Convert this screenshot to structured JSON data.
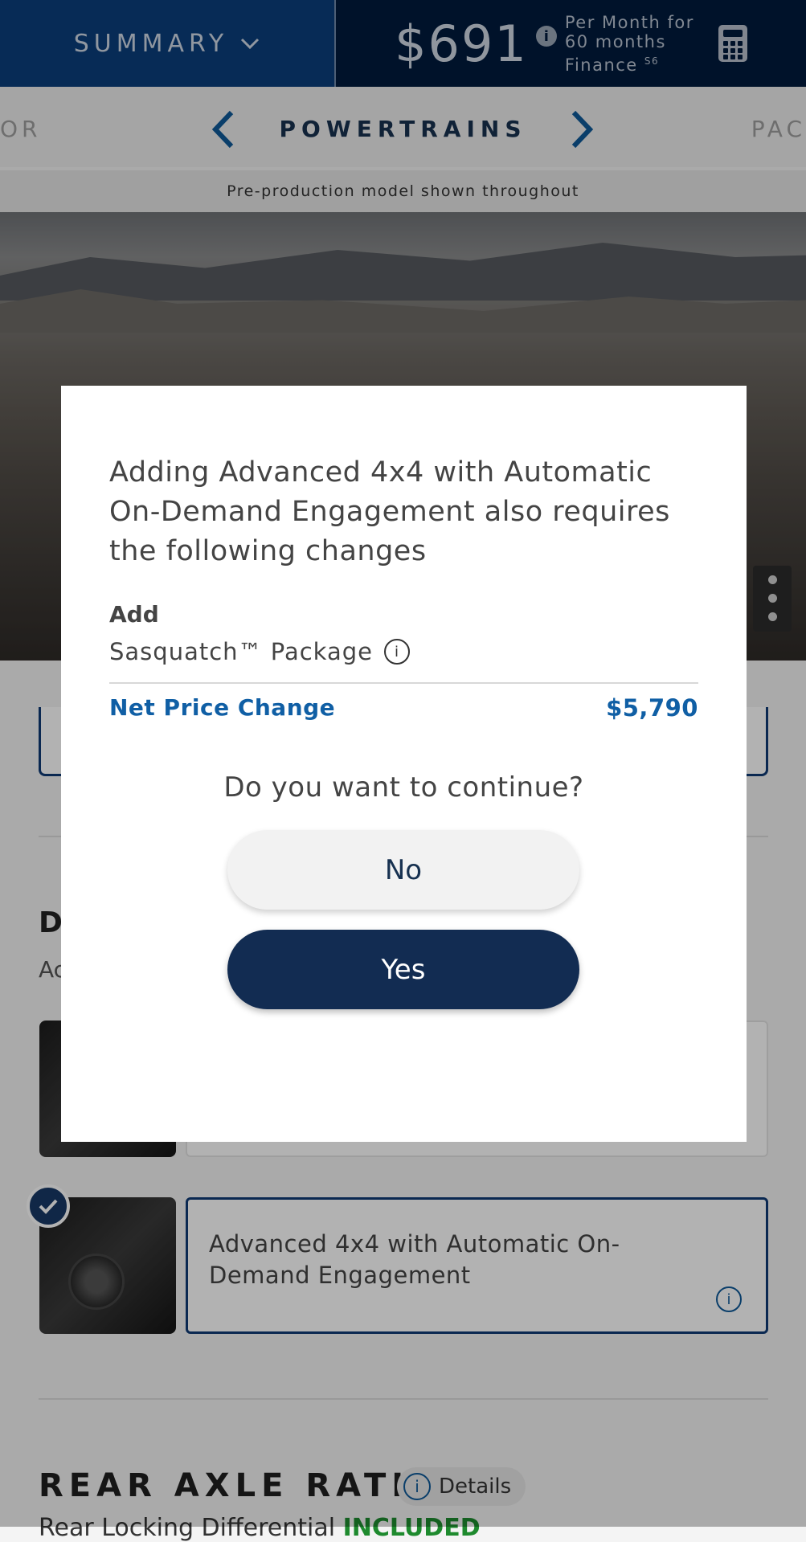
{
  "header": {
    "summary_label": "SUMMARY",
    "price": "$691",
    "price_info": "i",
    "per_month_line1": "Per Month for",
    "per_month_line2": "60 months",
    "per_month_line3": "Finance",
    "footnote": "S6"
  },
  "nav": {
    "prev_partial": "OR",
    "title": "POWERTRAINS",
    "next_partial": "PAC"
  },
  "disclaimer": "Pre-production model shown throughout",
  "background": {
    "section_head_partial": "D",
    "section_sub_partial": "Ac",
    "selected_option": "Advanced 4x4 with Automatic On-Demand Engagement",
    "info_glyph": "i",
    "rear_axle_title": "REAR AXLE RATIO",
    "details_label": "Details",
    "bottom_partial_text": "Rear Locking Differential ",
    "bottom_included": "INCLUDED"
  },
  "modal": {
    "title": "Adding Advanced 4x4 with Automatic On-Demand Engagement also requires the following changes",
    "add_label": "Add",
    "package_name": "Sasquatch™ Package",
    "info_glyph": "i",
    "net_price_label": "Net Price Change",
    "net_price_value": "$5,790",
    "question": "Do you want to continue?",
    "no_label": "No",
    "yes_label": "Yes"
  },
  "colors": {
    "summary_bg": "#0b3e7b",
    "price_bg": "#001a3d",
    "accent_blue": "#105fa5",
    "yes_button": "#122c52",
    "included_green": "#1e8a2e"
  }
}
